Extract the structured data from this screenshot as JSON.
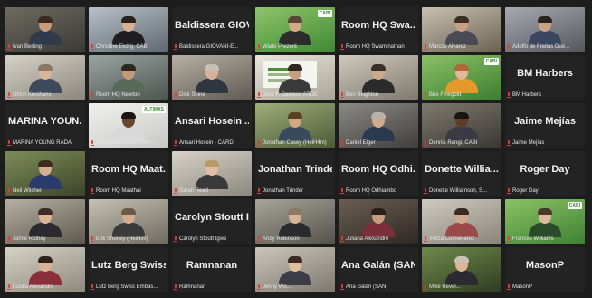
{
  "meeting": {
    "tiles": [
      {
        "id": "t01",
        "label": "Ivan Berting",
        "video": true,
        "active": true,
        "c1": "#6e6a60",
        "c2": "#3b3a36",
        "skin": "#c89a7c",
        "hair": "#3a2a20",
        "shirt": "#2f3a4a"
      },
      {
        "id": "t02",
        "label": "Christine Ekdrg, CABI",
        "video": true,
        "c1": "#b9c1c7",
        "c2": "#5f6870",
        "skin": "#d7b096",
        "hair": "#2a211c",
        "shirt": "#1f1f22"
      },
      {
        "id": "t03",
        "title": "Baldissera GIOV...",
        "label": "Baldissera GIOVANI-E...",
        "video": false
      },
      {
        "id": "t04",
        "label": "Wade Prezent",
        "video": true,
        "logo": "CABI",
        "c1": "#8fc46b",
        "c2": "#3f8a34",
        "skin": "#d4aa88",
        "hair": "#5a4634",
        "shirt": "#2c2c2c"
      },
      {
        "id": "t05",
        "title": "Room HQ Swa...",
        "label": "Room HQ Swaminathan",
        "video": false
      },
      {
        "id": "t06",
        "label": "Marcos Alvarez",
        "video": true,
        "c1": "#c8c0b0",
        "c2": "#6b6253",
        "skin": "#c9a083",
        "hair": "#3b2e22",
        "shirt": "#4a4a55"
      },
      {
        "id": "t07",
        "label": "Adolfo de Freitas Due...",
        "video": true,
        "c1": "#a9a9b0",
        "c2": "#55565e",
        "skin": "#caa286",
        "hair": "#2a2420",
        "shirt": "#3a4660"
      },
      {
        "id": "t08",
        "label": "Ulrich Kurshans",
        "video": true,
        "c1": "#d6d2c8",
        "c2": "#8c877d",
        "skin": "#d9b49a",
        "hair": "#8a7a64",
        "shirt": "#3c4a5c"
      },
      {
        "id": "t09",
        "label": "Room HQ Newton",
        "video": true,
        "c1": "#9aa4a0",
        "c2": "#4d5551",
        "skin": "#c49a7c",
        "hair": "#2c2620",
        "shirt": "#5a6a5a"
      },
      {
        "id": "t10",
        "label": "Dick Shine",
        "video": true,
        "c1": "#b7b0a4",
        "c2": "#5f5a52",
        "skin": "#d6b29a",
        "hair": "#c8c0b8",
        "shirt": "#2f3640"
      },
      {
        "id": "t11",
        "label": "José F. Campos ARDE",
        "video": true,
        "slide": true,
        "c1": "#e9e6dc",
        "c2": "#a9a596",
        "skin": "#c69e80",
        "hair": "#302820",
        "shirt": "#3a3a3a"
      },
      {
        "id": "t12",
        "label": "Ben Beighton",
        "video": true,
        "c1": "#cfc9bd",
        "c2": "#807a6e",
        "skin": "#d0a88a",
        "hair": "#3a2f26",
        "shirt": "#2b2b2b"
      },
      {
        "id": "t13",
        "label": "Brie Finegold",
        "video": true,
        "logo": "CABI",
        "c1": "#8dc067",
        "c2": "#3b7f30",
        "skin": "#e0b89a",
        "hair": "#b06a3a",
        "shirt": "#e39a2a"
      },
      {
        "id": "t14",
        "title": "BM Harbers",
        "label": "BM Harbers",
        "video": false
      },
      {
        "id": "t15",
        "title": "MARINA YOUN...",
        "label": "MARINA YOUNG RADA",
        "video": false
      },
      {
        "id": "t16",
        "label": "Athanase Yasmin John...",
        "video": true,
        "logo": "ALTIMAS",
        "c1": "#f0f0ee",
        "c2": "#c8c8c4",
        "skin": "#6a4630",
        "hair": "#1a1412",
        "shirt": "#d9d9d9"
      },
      {
        "id": "t17",
        "title": "Ansari Hosein ...",
        "label": "Ansari Hosein - CARDI",
        "video": false
      },
      {
        "id": "t18",
        "label": "Jonathan Casey (HeiH4m)",
        "video": true,
        "c1": "#9fae7a",
        "c2": "#4c5a36",
        "skin": "#d3a784",
        "hair": "#5a4020",
        "shirt": "#3a4a5c"
      },
      {
        "id": "t19",
        "label": "Daniel Elger",
        "video": true,
        "c1": "#8c8a86",
        "c2": "#3f3e3b",
        "skin": "#d1aa8f",
        "hair": "#b8b2aa",
        "shirt": "#2c3a50"
      },
      {
        "id": "t20",
        "label": "Dennis Rangi, CABI",
        "video": true,
        "c1": "#7f7a70",
        "c2": "#3a3732",
        "skin": "#5e3e2a",
        "hair": "#1a1512",
        "shirt": "#3a3a44"
      },
      {
        "id": "t21",
        "title": "Jaime Mejías",
        "label": "Jaime Mejías",
        "video": false
      },
      {
        "id": "t22",
        "label": "Neil Wilcher",
        "video": true,
        "c1": "#7e8c5a",
        "c2": "#3c4428",
        "skin": "#d6ae90",
        "hair": "#3a2e22",
        "shirt": "#2a3a6a"
      },
      {
        "id": "t23",
        "title": "Room HQ Maat...",
        "label": "Room HQ Maathai",
        "video": false
      },
      {
        "id": "t24",
        "label": "Sarah Reed",
        "video": true,
        "c1": "#d7d3c9",
        "c2": "#8c887e",
        "skin": "#e1bea4",
        "hair": "#b89a6a",
        "shirt": "#3a3a3a"
      },
      {
        "id": "t25",
        "title": "Jonathan Trinder",
        "label": "Jonathan Trinder",
        "video": false
      },
      {
        "id": "t26",
        "title": "Room HQ Odhi...",
        "label": "Room HQ Odhiambo",
        "video": false
      },
      {
        "id": "t27",
        "title": "Donette Willia...",
        "label": "Donette Williamson, S...",
        "video": false
      },
      {
        "id": "t28",
        "title": "Roger Day",
        "label": "Roger Day",
        "video": false
      },
      {
        "id": "t29",
        "label": "Jamie Rothey",
        "video": true,
        "c1": "#b6b0a2",
        "c2": "#5e594e",
        "skin": "#dcb598",
        "hair": "#3a2e26",
        "shirt": "#2a2a30"
      },
      {
        "id": "t30",
        "label": "Erik Shorley (HeiHim)",
        "video": true,
        "c1": "#c7c1b4",
        "c2": "#6f6a60",
        "skin": "#d4ad90",
        "hair": "#6a5a48",
        "shirt": "#3a3a3a"
      },
      {
        "id": "t31",
        "title": "Carolyn Stoutt I...",
        "label": "Carolyn Stoutt Igwe",
        "video": false
      },
      {
        "id": "t32",
        "label": "Andy Robinson",
        "video": true,
        "c1": "#a7a49a",
        "c2": "#55524a",
        "skin": "#d9b398",
        "hair": "#8a7a62",
        "shirt": "#2a2a2e"
      },
      {
        "id": "t33",
        "label": "Juliana Alexandre",
        "video": true,
        "c1": "#6a5e52",
        "c2": "#2f2924",
        "skin": "#c79c7c",
        "hair": "#2a1e16",
        "shirt": "#7a2f3a"
      },
      {
        "id": "t34",
        "label": "Yeltza Colmenarez",
        "video": true,
        "c1": "#cfcac0",
        "c2": "#8a857b",
        "skin": "#d2a88a",
        "hair": "#3a2c22",
        "shirt": "#9a4a4a"
      },
      {
        "id": "t35",
        "label": "Frances Williams",
        "video": true,
        "logo": "CABI",
        "c1": "#8cc266",
        "c2": "#3c8232",
        "skin": "#dfb99c",
        "hair": "#4a3a2a",
        "shirt": "#2a4a2a"
      },
      {
        "id": "t36",
        "label": "Lusilla Alexandre",
        "video": true,
        "c1": "#d7d2c6",
        "c2": "#8e897c",
        "skin": "#dcb294",
        "hair": "#2e241c",
        "shirt": "#8a2f3a"
      },
      {
        "id": "t37",
        "title": "Lutz Berg Swiss...",
        "label": "Lutz Berg Swiss Embas...",
        "video": false
      },
      {
        "id": "t38",
        "title": "Ramnanan",
        "label": "Ramnanan",
        "video": false
      },
      {
        "id": "t39",
        "label": "Jenny Wo...",
        "video": true,
        "c1": "#cac6bc",
        "c2": "#7d796f",
        "skin": "#e0bca0",
        "hair": "#3a2a22",
        "shirt": "#3c3c46"
      },
      {
        "id": "t40",
        "title": "Ana Galán (SAN)",
        "label": "Ana Galán (SAN)",
        "video": false
      },
      {
        "id": "t41",
        "label": "Mike Revel...",
        "video": true,
        "c1": "#6f8a4a",
        "c2": "#2f3c22",
        "skin": "#dcb496",
        "hair": "#c9c2b6",
        "shirt": "#2a2a30"
      },
      {
        "id": "t42",
        "title": "MasonP",
        "label": "MasonP",
        "video": false
      }
    ]
  }
}
